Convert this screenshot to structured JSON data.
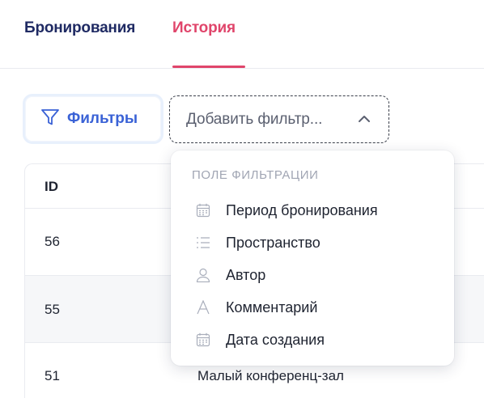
{
  "tabs": [
    {
      "label": "Бронирования",
      "active": false
    },
    {
      "label": "История",
      "active": true
    }
  ],
  "toolbar": {
    "filters_label": "Фильтры",
    "add_filter_label": "Добавить фильтр..."
  },
  "table": {
    "columns": [
      "ID"
    ],
    "rows": [
      {
        "id": "56",
        "space": ""
      },
      {
        "id": "55",
        "space": ""
      },
      {
        "id": "51",
        "space": "Малый конференц-зал"
      }
    ]
  },
  "dropdown": {
    "title": "ПОЛЕ ФИЛЬТРАЦИИ",
    "items": [
      {
        "label": "Период бронирования",
        "icon": "calendar-icon"
      },
      {
        "label": "Пространство",
        "icon": "list-icon"
      },
      {
        "label": "Автор",
        "icon": "user-icon"
      },
      {
        "label": "Комментарий",
        "icon": "text-icon"
      },
      {
        "label": "Дата создания",
        "icon": "calendar-icon"
      }
    ]
  },
  "colors": {
    "active_tab": "#e0456b",
    "inactive_tab": "#1f2a63",
    "accent": "#3a62d6",
    "icon_gray": "#a9aebb"
  }
}
